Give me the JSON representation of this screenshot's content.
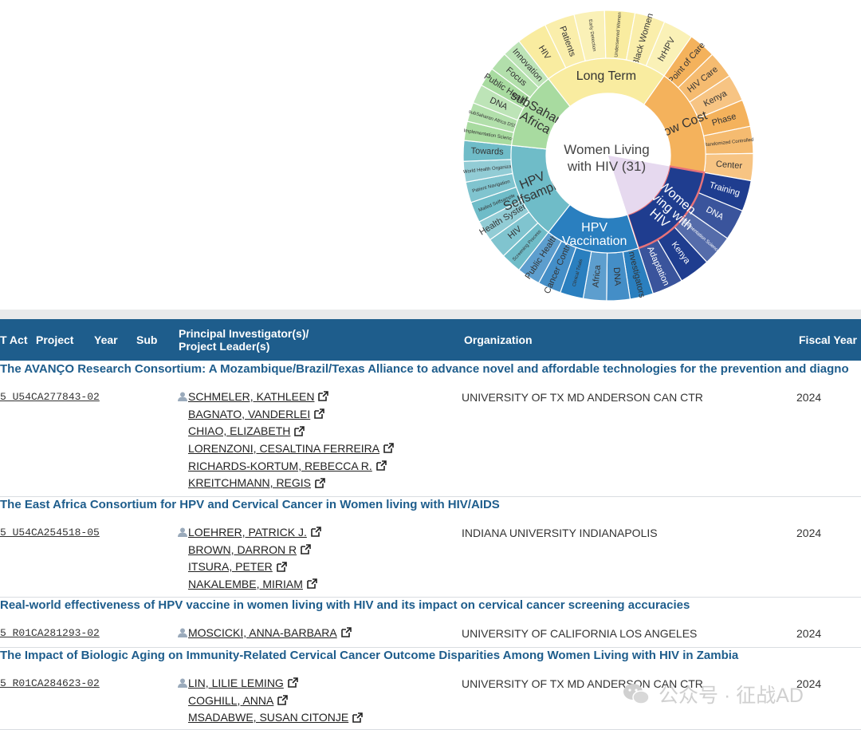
{
  "sunburst": {
    "center_label_line1": "Women Living",
    "center_label_line2": "with HIV (31)",
    "segments": [
      {
        "label": "Long Term",
        "color": "#f9eca0",
        "start": -38,
        "end": 35,
        "level": "inner"
      },
      {
        "label": "Low Cost",
        "color": "#f4b25c",
        "start": 35,
        "end": 100,
        "level": "inner"
      },
      {
        "label": "Women Living with HIV",
        "color": "#1f3d8f",
        "start": 100,
        "end": 162,
        "level": "inner",
        "selected": true
      },
      {
        "label": "HPV Vaccination",
        "color": "#2a7fbf",
        "start": 162,
        "end": 218,
        "level": "inner"
      },
      {
        "label": "HPV Selfsampling",
        "color": "#6fbcc8",
        "start": 218,
        "end": 276,
        "level": "inner"
      },
      {
        "label": "subSaharan Africa",
        "color": "#a8dba0",
        "start": 276,
        "end": 322,
        "level": "inner"
      }
    ],
    "outer_labels": [
      "HIV",
      "Patients",
      "Early Detection",
      "Underserved Women",
      "Black Women",
      "hrHPV",
      "Point of Care",
      "HIV Care",
      "Kenya",
      "Phase",
      "Randomized Controlled Trial",
      "Center",
      "Training",
      "DNA",
      "Implementation Science",
      "Kenya",
      "Adaptation",
      "Investigators",
      "DNA",
      "Africa",
      "Clinical Trials",
      "Cancer Control",
      "Public Health",
      "Screening Process",
      "HIV",
      "Health System",
      "Mailed Selfsample",
      "Patient Navigation",
      "World Health Organization",
      "Towards",
      "Implementation Science",
      "subSaharan Africa DSS Clinical Trials",
      "DNA",
      "Public Health",
      "Focus",
      "Innovation"
    ]
  },
  "table": {
    "headers": {
      "act": "T Act",
      "project": "Project",
      "year": "Year",
      "sub": "Sub",
      "pi": "Principal Investigator(s)/ Project Leader(s)",
      "org": "Organization",
      "fy": "Fiscal Year"
    },
    "grants": [
      {
        "title": "The AVANÇO Research Consortium: A Mozambique/Brazil/Texas Alliance to advance novel and affordable technologies for the prevention and diagno",
        "project": "5 U54CA277843-02",
        "pis": [
          "SCHMELER, KATHLEEN",
          "BAGNATO, VANDERLEI",
          "CHIAO, ELIZABETH",
          "LORENZONI, CESALTINA FERREIRA",
          "RICHARDS-KORTUM, REBECCA R.",
          "KREITCHMANN, REGIS"
        ],
        "org": "UNIVERSITY OF TX MD ANDERSON CAN CTR",
        "fy": "2024"
      },
      {
        "title": "The East Africa Consortium for HPV and Cervical Cancer in Women living with HIV/AIDS",
        "project": "5 U54CA254518-05",
        "pis": [
          "LOEHRER, PATRICK J.",
          "BROWN, DARRON R",
          "ITSURA, PETER",
          "NAKALEMBE, MIRIAM"
        ],
        "org": "INDIANA UNIVERSITY INDIANAPOLIS",
        "fy": "2024"
      },
      {
        "title": "Real-world effectiveness of HPV vaccine in women living with HIV and its impact on cervical cancer screening accuracies",
        "project": "5 R01CA281293-02",
        "pis": [
          "MOSCICKI, ANNA-BARBARA"
        ],
        "org": "UNIVERSITY OF CALIFORNIA LOS ANGELES",
        "fy": "2024"
      },
      {
        "title": "The Impact of Biologic Aging on Immunity-Related Cervical Cancer Outcome Disparities Among Women Living with HIV in Zambia",
        "project": "5 R01CA284623-02",
        "pis": [
          "LIN, LILIE LEMING",
          "COGHILL, ANNA",
          "MSADABWE, SUSAN CITONJE"
        ],
        "org": "UNIVERSITY OF TX MD ANDERSON CAN CTR",
        "fy": "2024"
      }
    ]
  },
  "watermark": "公众号 · 征战AD"
}
